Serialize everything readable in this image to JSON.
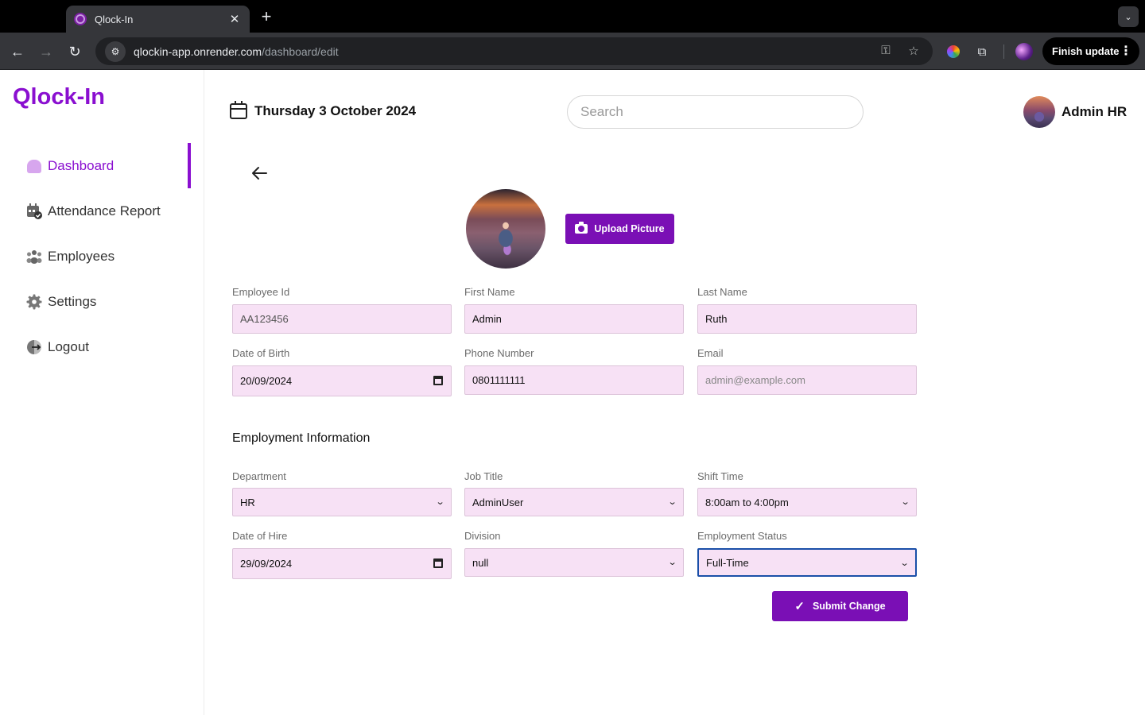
{
  "browser": {
    "tab_title": "Qlock-In",
    "url_host": "qlockin-app.onrender.com",
    "url_path": "/dashboard/edit",
    "finish_update_label": "Finish update"
  },
  "sidebar": {
    "brand": "Qlock-In",
    "brand_color": "#8a0fd0",
    "items": [
      {
        "label": "Dashboard",
        "icon": "home-icon",
        "active": true
      },
      {
        "label": "Attendance Report",
        "icon": "calendar-check-icon",
        "active": false
      },
      {
        "label": "Employees",
        "icon": "people-icon",
        "active": false
      },
      {
        "label": "Settings",
        "icon": "gear-icon",
        "active": false
      },
      {
        "label": "Logout",
        "icon": "logout-icon",
        "active": false
      }
    ]
  },
  "header": {
    "date": "Thursday 3 October 2024",
    "search_placeholder": "Search",
    "user_name": "Admin HR"
  },
  "profile": {
    "upload_label": "Upload Picture"
  },
  "personal": {
    "employee_id": {
      "label": "Employee Id",
      "value": "AA123456"
    },
    "first_name": {
      "label": "First Name",
      "value": "Admin"
    },
    "last_name": {
      "label": "Last Name",
      "value": "Ruth"
    },
    "dob": {
      "label": "Date of Birth",
      "value": "20/09/2024"
    },
    "phone": {
      "label": "Phone Number",
      "value": "0801111111"
    },
    "email": {
      "label": "Email",
      "placeholder": "admin@example.com"
    }
  },
  "employment": {
    "title": "Employment Information",
    "department": {
      "label": "Department",
      "value": "HR"
    },
    "job_title": {
      "label": "Job Title",
      "value": "AdminUser"
    },
    "shift_time": {
      "label": "Shift Time",
      "value": "8:00am to 4:00pm"
    },
    "date_of_hire": {
      "label": "Date of Hire",
      "value": "29/09/2024"
    },
    "division": {
      "label": "Division",
      "value": "null"
    },
    "employment_status": {
      "label": "Employment Status",
      "value": "Full-Time"
    }
  },
  "actions": {
    "submit_label": "Submit Change",
    "accent_color": "#7a0fb5"
  }
}
